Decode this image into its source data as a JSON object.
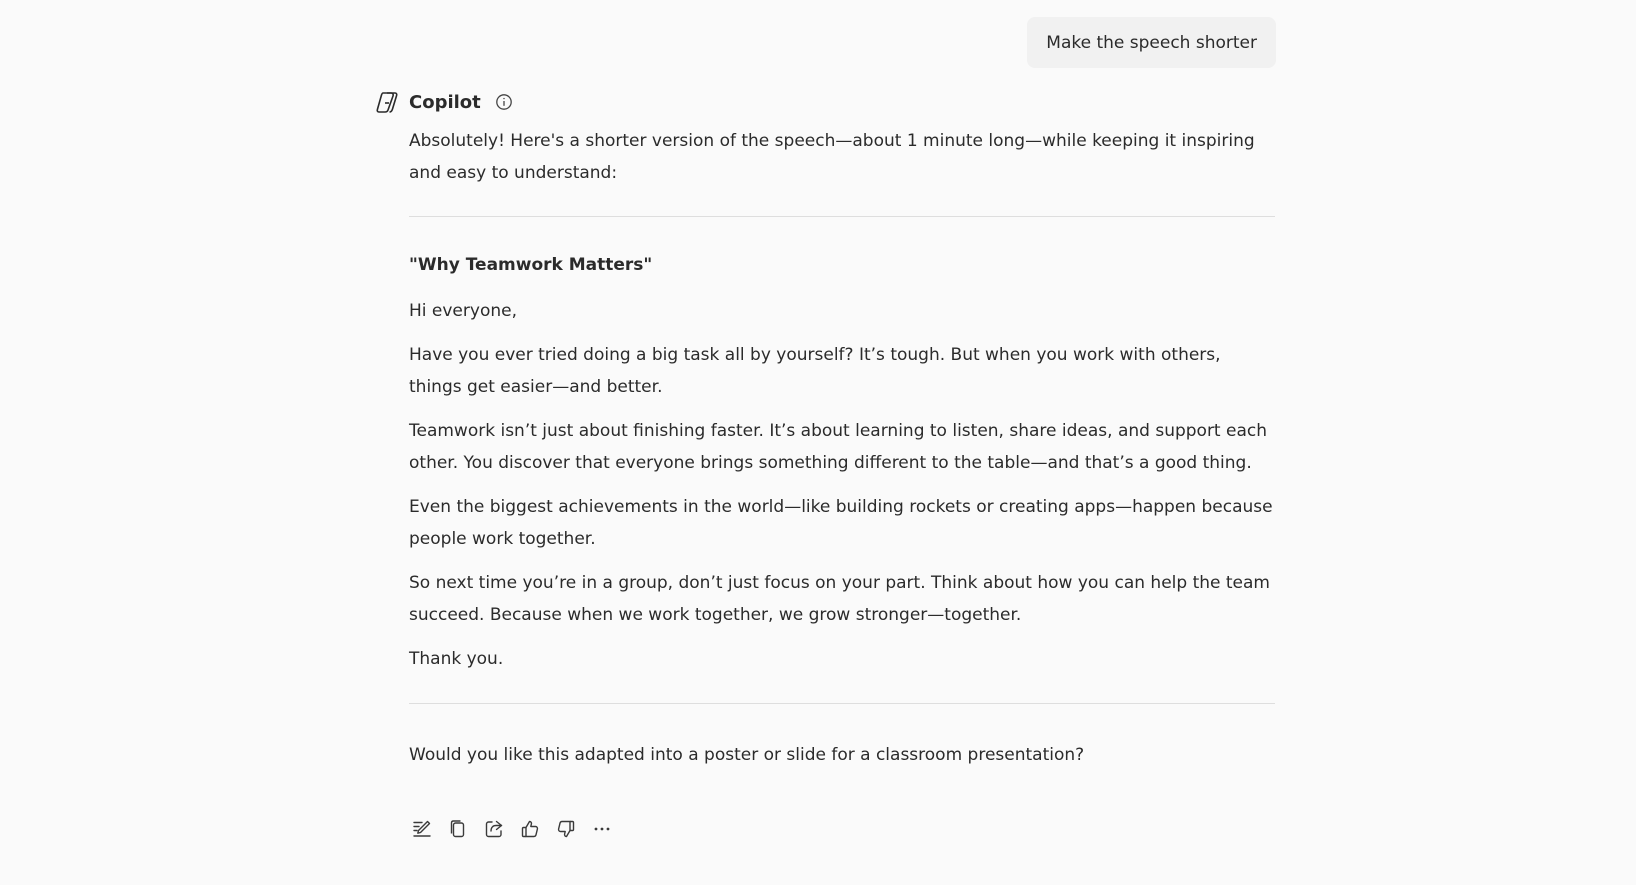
{
  "user_message": {
    "text": "Make the speech shorter"
  },
  "assistant": {
    "name": "Copilot",
    "logo_icon": "copilot-logo-icon",
    "info_icon": "info-icon",
    "intro": "Absolutely! Here's a shorter version of the speech—about 1 minute long—while keeping it inspiring and easy to understand:",
    "speech": {
      "title": "\"Why Teamwork Matters\"",
      "paragraphs": [
        "Hi everyone,",
        "Have you ever tried doing a big task all by yourself? It’s tough. But when you work with others, things get easier—and better.",
        "Teamwork isn’t just about finishing faster. It’s about learning to listen, share ideas, and support each other. You discover that everyone brings something different to the table—and that’s a good thing.",
        "Even the biggest achievements in the world—like building rockets or creating apps—happen because people work together.",
        "So next time you’re in a group, don’t just focus on your part. Think about how you can help the team succeed. Because when we work together, we grow stronger—together.",
        "Thank you."
      ]
    },
    "followup": "Would you like this adapted into a poster or slide for a classroom presentation?"
  },
  "actions": [
    {
      "icon": "edit-icon"
    },
    {
      "icon": "copy-icon"
    },
    {
      "icon": "share-icon"
    },
    {
      "icon": "thumbs-up-icon"
    },
    {
      "icon": "thumbs-down-icon"
    },
    {
      "icon": "more-icon"
    }
  ]
}
